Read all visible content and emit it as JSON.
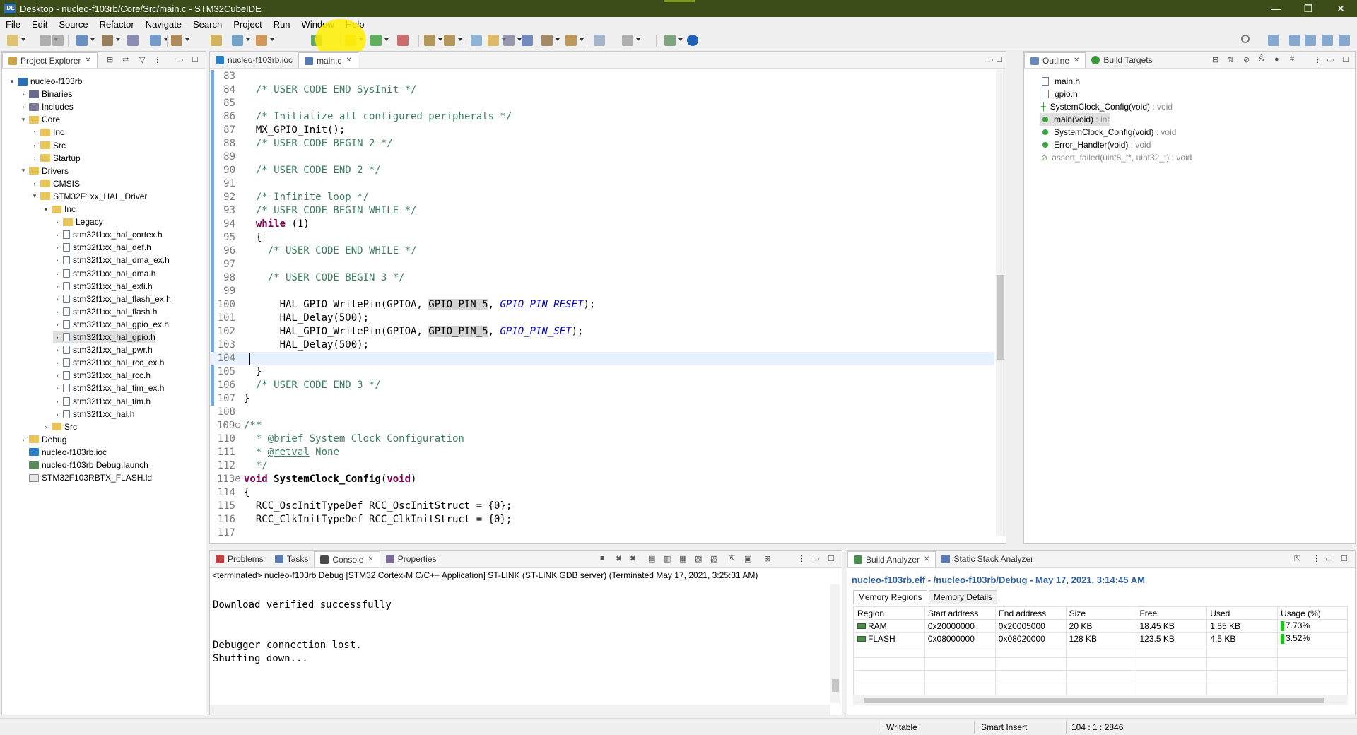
{
  "window": {
    "app_badge": "IDE",
    "title": "Desktop - nucleo-f103rb/Core/Src/main.c - STM32CubeIDE",
    "controls": {
      "minimize": "—",
      "restore": "❐",
      "close": "✕"
    }
  },
  "menu": {
    "items": [
      "File",
      "Edit",
      "Source",
      "Refactor",
      "Navigate",
      "Search",
      "Project",
      "Run",
      "Window",
      "Help"
    ]
  },
  "project_explorer": {
    "tab_label": "Project Explorer",
    "tree": [
      {
        "label": "nucleo-f103rb",
        "level": 0,
        "expander": "▾",
        "icon": "ide-project-icon"
      },
      {
        "label": "Binaries",
        "level": 1,
        "expander": "›",
        "icon": "binaries-icon"
      },
      {
        "label": "Includes",
        "level": 1,
        "expander": "›",
        "icon": "includes-icon"
      },
      {
        "label": "Core",
        "level": 1,
        "expander": "▾",
        "icon": "folder-icon"
      },
      {
        "label": "Inc",
        "level": 2,
        "expander": "›",
        "icon": "folder-icon"
      },
      {
        "label": "Src",
        "level": 2,
        "expander": "›",
        "icon": "folder-icon"
      },
      {
        "label": "Startup",
        "level": 2,
        "expander": "›",
        "icon": "folder-icon"
      },
      {
        "label": "Drivers",
        "level": 1,
        "expander": "▾",
        "icon": "folder-icon"
      },
      {
        "label": "CMSIS",
        "level": 2,
        "expander": "›",
        "icon": "folder-icon"
      },
      {
        "label": "STM32F1xx_HAL_Driver",
        "level": 2,
        "expander": "▾",
        "icon": "folder-icon"
      },
      {
        "label": "Inc",
        "level": 3,
        "expander": "▾",
        "icon": "folder-icon"
      },
      {
        "label": "Legacy",
        "level": 4,
        "expander": "›",
        "icon": "folder-icon"
      },
      {
        "label": "stm32f1xx_hal_cortex.h",
        "level": 4,
        "expander": "›",
        "icon": "header-file-icon"
      },
      {
        "label": "stm32f1xx_hal_def.h",
        "level": 4,
        "expander": "›",
        "icon": "header-file-icon"
      },
      {
        "label": "stm32f1xx_hal_dma_ex.h",
        "level": 4,
        "expander": "›",
        "icon": "header-file-icon"
      },
      {
        "label": "stm32f1xx_hal_dma.h",
        "level": 4,
        "expander": "›",
        "icon": "header-file-icon"
      },
      {
        "label": "stm32f1xx_hal_exti.h",
        "level": 4,
        "expander": "›",
        "icon": "header-file-icon"
      },
      {
        "label": "stm32f1xx_hal_flash_ex.h",
        "level": 4,
        "expander": "›",
        "icon": "header-file-icon"
      },
      {
        "label": "stm32f1xx_hal_flash.h",
        "level": 4,
        "expander": "›",
        "icon": "header-file-icon"
      },
      {
        "label": "stm32f1xx_hal_gpio_ex.h",
        "level": 4,
        "expander": "›",
        "icon": "header-file-icon"
      },
      {
        "label": "stm32f1xx_hal_gpio.h",
        "level": 4,
        "expander": "›",
        "icon": "header-file-icon",
        "selected": true
      },
      {
        "label": "stm32f1xx_hal_pwr.h",
        "level": 4,
        "expander": "›",
        "icon": "header-file-icon"
      },
      {
        "label": "stm32f1xx_hal_rcc_ex.h",
        "level": 4,
        "expander": "›",
        "icon": "header-file-icon"
      },
      {
        "label": "stm32f1xx_hal_rcc.h",
        "level": 4,
        "expander": "›",
        "icon": "header-file-icon"
      },
      {
        "label": "stm32f1xx_hal_tim_ex.h",
        "level": 4,
        "expander": "›",
        "icon": "header-file-icon"
      },
      {
        "label": "stm32f1xx_hal_tim.h",
        "level": 4,
        "expander": "›",
        "icon": "header-file-icon"
      },
      {
        "label": "stm32f1xx_hal.h",
        "level": 4,
        "expander": "›",
        "icon": "header-file-icon"
      },
      {
        "label": "Src",
        "level": 3,
        "expander": "›",
        "icon": "folder-icon"
      },
      {
        "label": "Debug",
        "level": 1,
        "expander": "›",
        "icon": "folder-icon"
      },
      {
        "label": "nucleo-f103rb.ioc",
        "level": 1,
        "expander": "",
        "icon": "mx-file-icon"
      },
      {
        "label": "nucleo-f103rb Debug.launch",
        "level": 1,
        "expander": "",
        "icon": "launch-file-icon"
      },
      {
        "label": "STM32F103RBTX_FLASH.ld",
        "level": 1,
        "expander": "",
        "icon": "ld-file-icon"
      }
    ]
  },
  "editor": {
    "tabs": [
      {
        "label": "nucleo-f103rb.ioc",
        "active": false,
        "icon": "mx-file-icon"
      },
      {
        "label": "main.c",
        "active": true,
        "icon": "c-file-icon",
        "close": "✕"
      }
    ],
    "lines": [
      {
        "n": "83",
        "html": ""
      },
      {
        "n": "84",
        "html": "  <span class='cm'>/* USER CODE END SysInit */</span>"
      },
      {
        "n": "85",
        "html": ""
      },
      {
        "n": "86",
        "html": "  <span class='cm'>/* Initialize all configured peripherals */</span>"
      },
      {
        "n": "87",
        "html": "  MX_GPIO_Init();"
      },
      {
        "n": "88",
        "html": "  <span class='cm'>/* USER CODE BEGIN 2 */</span>"
      },
      {
        "n": "89",
        "html": ""
      },
      {
        "n": "90",
        "html": "  <span class='cm'>/* USER CODE END 2 */</span>"
      },
      {
        "n": "91",
        "html": ""
      },
      {
        "n": "92",
        "html": "  <span class='cm'>/* Infinite loop */</span>"
      },
      {
        "n": "93",
        "html": "  <span class='cm'>/* USER CODE BEGIN WHILE */</span>"
      },
      {
        "n": "94",
        "html": "  <span class='kw'>while</span> (1)"
      },
      {
        "n": "95",
        "html": "  {"
      },
      {
        "n": "96",
        "html": "    <span class='cm'>/* USER CODE END WHILE */</span>"
      },
      {
        "n": "97",
        "html": ""
      },
      {
        "n": "98",
        "html": "    <span class='cm'>/* USER CODE BEGIN 3 */</span>"
      },
      {
        "n": "99",
        "html": ""
      },
      {
        "n": "100",
        "html": "      HAL_GPIO_WritePin(GPIOA, <span class='occ'>GPIO_PIN_5</span>, <span class='em'>GPIO_PIN_RESET</span>);"
      },
      {
        "n": "101",
        "html": "      HAL_Delay(500);"
      },
      {
        "n": "102",
        "html": "      HAL_GPIO_WritePin(GPIOA, <span class='occ'>GPIO_PIN_5</span>, <span class='em'>GPIO_PIN_SET</span>);"
      },
      {
        "n": "103",
        "html": "      HAL_Delay(500);"
      },
      {
        "n": "104",
        "html": "",
        "current": true
      },
      {
        "n": "105",
        "html": "  }"
      },
      {
        "n": "106",
        "html": "  <span class='cm'>/* USER CODE END 3 */</span>"
      },
      {
        "n": "107",
        "html": "}"
      },
      {
        "n": "108",
        "html": ""
      },
      {
        "n": "109⊖",
        "html": "<span class='cm'>/**</span>"
      },
      {
        "n": "110",
        "html": "<span class='cm'>  * @brief System Clock Configuration</span>"
      },
      {
        "n": "111",
        "html": "<span class='cm'>  * <u>@retval</u> None</span>"
      },
      {
        "n": "112",
        "html": "<span class='cm'>  */</span>"
      },
      {
        "n": "113⊖",
        "html": "<span class='kw'>void</span> <span class='hl-bold'>SystemClock_Config</span>(<span class='kw'>void</span>)"
      },
      {
        "n": "114",
        "html": "{"
      },
      {
        "n": "115",
        "html": "  RCC_OscInitTypeDef RCC_OscInitStruct = {0};"
      },
      {
        "n": "116",
        "html": "  RCC_ClkInitTypeDef RCC_ClkInitStruct = {0};"
      },
      {
        "n": "117",
        "html": ""
      }
    ]
  },
  "outline": {
    "tabs": [
      {
        "label": "Outline",
        "icon": "outline-icon"
      },
      {
        "label": "Build Targets",
        "icon": "build-targets-icon"
      }
    ],
    "items": [
      {
        "label": "main.h",
        "suffix": "",
        "icon": "header-include-icon"
      },
      {
        "label": "gpio.h",
        "suffix": "",
        "icon": "header-include-icon"
      },
      {
        "label": "SystemClock_Config(void)",
        "suffix": " : void",
        "icon": "function-declaration-icon"
      },
      {
        "label": "main(void)",
        "suffix": " : int",
        "icon": "function-icon",
        "selected": true
      },
      {
        "label": "SystemClock_Config(void)",
        "suffix": " : void",
        "icon": "function-icon"
      },
      {
        "label": "Error_Handler(void)",
        "suffix": " : void",
        "icon": "function-icon"
      },
      {
        "label": "assert_failed(uint8_t*, uint32_t)",
        "suffix": " : void",
        "icon": "inactive-function-icon",
        "dim": true
      }
    ]
  },
  "console": {
    "tabs": [
      {
        "label": "Problems",
        "icon": "problems-icon"
      },
      {
        "label": "Tasks",
        "icon": "tasks-icon"
      },
      {
        "label": "Console",
        "icon": "console-icon",
        "active": true,
        "close": "✕"
      },
      {
        "label": "Properties",
        "icon": "properties-icon"
      }
    ],
    "status_line": "<terminated> nucleo-f103rb Debug [STM32 Cortex-M C/C++ Application] ST-LINK (ST-LINK GDB server) (Terminated May 17, 2021, 3:25:31 AM)",
    "lines": [
      "",
      "Download verified successfully",
      "",
      "",
      "Debugger connection lost.",
      "Shutting down..."
    ]
  },
  "build_analyzer": {
    "tabs": [
      {
        "label": "Build Analyzer",
        "icon": "build-analyzer-icon",
        "active": true,
        "close": "✕"
      },
      {
        "label": "Static Stack Analyzer",
        "icon": "stack-analyzer-icon"
      }
    ],
    "header": "nucleo-f103rb.elf - /nucleo-f103rb/Debug - May 17, 2021, 3:14:45 AM",
    "subtabs": [
      "Memory Regions",
      "Memory Details"
    ],
    "columns": [
      "Region",
      "Start address",
      "End address",
      "Size",
      "Free",
      "Used",
      "Usage (%)"
    ],
    "rows": [
      {
        "region": "RAM",
        "start": "0x20000000",
        "end": "0x20005000",
        "size": "20 KB",
        "free": "18.45 KB",
        "used": "1.55 KB",
        "usage": "7.73%"
      },
      {
        "region": "FLASH",
        "start": "0x08000000",
        "end": "0x08020000",
        "size": "128 KB",
        "free": "123.5 KB",
        "used": "4.5 KB",
        "usage": "3.52%"
      }
    ]
  },
  "statusbar": {
    "mode": "Writable",
    "insert": "Smart Insert",
    "position": "104 : 1 : 2846"
  },
  "colors": {
    "titlebar": "#3d4d1a",
    "comment": "#3f7f5f",
    "keyword": "#7f0055",
    "highlight_circle": "#ffee00",
    "usage_bar": "#19c619"
  }
}
